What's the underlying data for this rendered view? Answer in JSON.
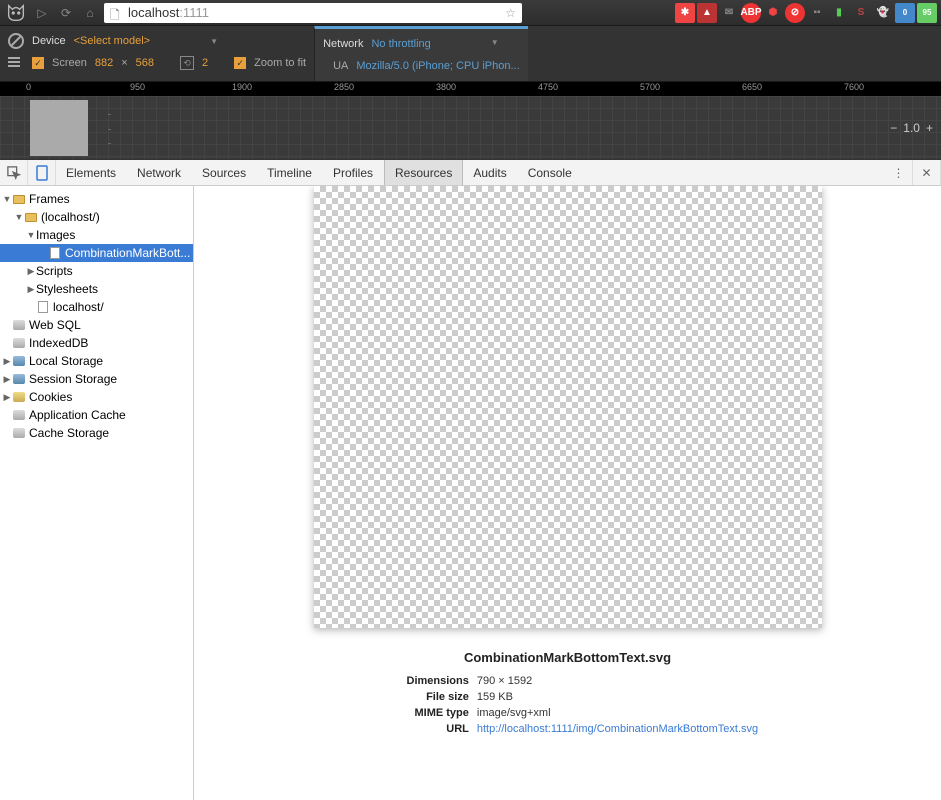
{
  "toolbar": {
    "url_host": "localhost",
    "url_port": ":1111"
  },
  "device_bar": {
    "no_label": "",
    "device_label": "Device",
    "device_value": "<Select model>",
    "screen_label": "Screen",
    "width": "882",
    "mult": "×",
    "height": "568",
    "dpr": "2",
    "zoom_label": "Zoom to fit",
    "net_label": "Network",
    "net_value": "No throttling",
    "ua_label": "UA",
    "ua_value": "Mozilla/5.0 (iPhone; CPU iPhon..."
  },
  "ruler_ticks": [
    "0",
    "950",
    "1900",
    "2850",
    "3800",
    "4750",
    "5700",
    "6650",
    "7600"
  ],
  "zoom_level": "1.0",
  "devtools_tabs": [
    "Elements",
    "Network",
    "Sources",
    "Timeline",
    "Profiles",
    "Resources",
    "Audits",
    "Console"
  ],
  "active_tab_index": 5,
  "sidebar": {
    "frames": "Frames",
    "localhost": "(localhost/)",
    "images": "Images",
    "image_file": "CombinationMarkBott...",
    "scripts": "Scripts",
    "stylesheets": "Stylesheets",
    "localhost_file": "localhost/",
    "websql": "Web SQL",
    "indexeddb": "IndexedDB",
    "localstorage": "Local Storage",
    "sessionstorage": "Session Storage",
    "cookies": "Cookies",
    "appcache": "Application Cache",
    "cachestorage": "Cache Storage"
  },
  "resource": {
    "title": "CombinationMarkBottomText.svg",
    "dim_label": "Dimensions",
    "dim_val": "790 × 1592",
    "size_label": "File size",
    "size_val": "159 KB",
    "mime_label": "MIME type",
    "mime_val": "image/svg+xml",
    "url_label": "URL",
    "url_val": "http://localhost:1111/img/CombinationMarkBottomText.svg"
  }
}
